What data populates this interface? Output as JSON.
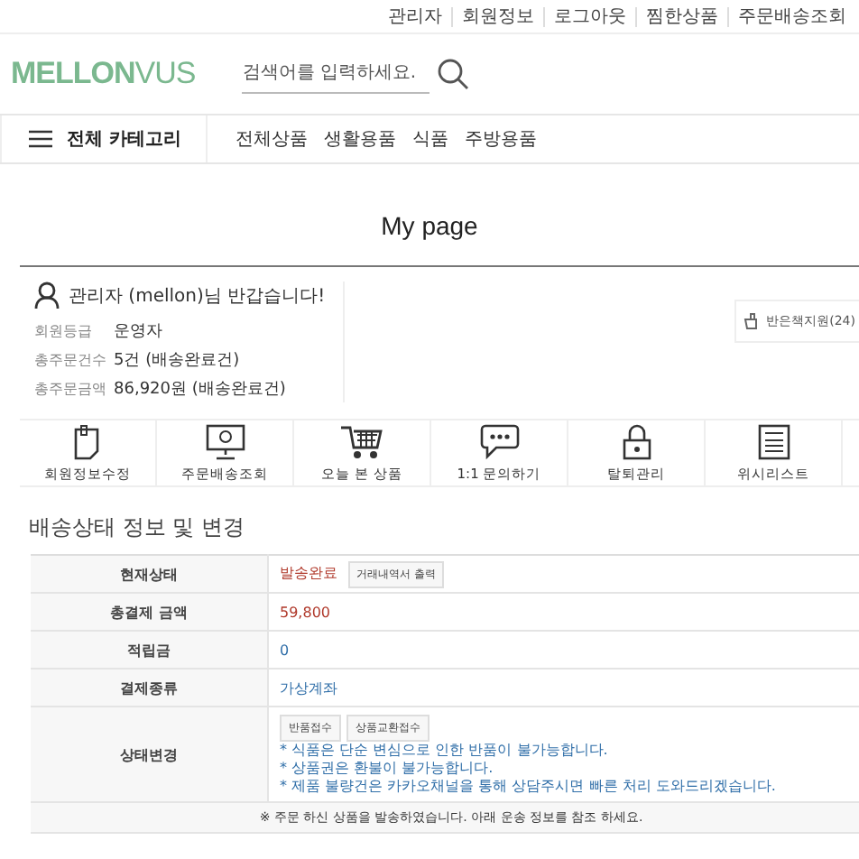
{
  "top_links": [
    "관리자",
    "회원정보",
    "로그아웃",
    "찜한상품",
    "주문배송조회"
  ],
  "logo": {
    "left": "MELLON",
    "right": "VUS"
  },
  "search": {
    "placeholder": "검색어를 입력하세요."
  },
  "nav": {
    "category_button": "전체 카테고리",
    "items": [
      "전체상품",
      "생활용품",
      "식품",
      "주방용품"
    ]
  },
  "page_title": "My page",
  "profile": {
    "greeting": "관리자 (mellon)님 반갑습니다!",
    "fields": [
      {
        "label": "회원등급",
        "value": "운영자"
      },
      {
        "label": "총주문건수",
        "value": "5건 (배송완료건)"
      },
      {
        "label": "총주문금액",
        "value": "86,920원 (배송완료건)"
      }
    ],
    "side_button": "반은책지원(24)"
  },
  "shortcuts": [
    {
      "label": "회원정보수정",
      "kind": "edit"
    },
    {
      "label": "주문배송조회",
      "kind": "monitor"
    },
    {
      "label": "오늘 본 상품",
      "kind": "cart"
    },
    {
      "label": "1:1 문의하기",
      "kind": "chat"
    },
    {
      "label": "탈퇴관리",
      "kind": "lock"
    },
    {
      "label": "위시리스트",
      "kind": "list"
    }
  ],
  "section_title": "배송상태 정보 및 변경",
  "rows": [
    {
      "label": "현재상태",
      "kind": "status",
      "value": "발송완료",
      "button": "거래내역서 출력"
    },
    {
      "label": "총결제 금액",
      "kind": "amount",
      "value": "59,800"
    },
    {
      "label": "적립금",
      "kind": "points",
      "value": "0"
    },
    {
      "label": "결제종류",
      "kind": "payment",
      "value": "가상계좌"
    },
    {
      "label": "상태변경",
      "kind": "change",
      "buttons": [
        "반품접수",
        "상품교환접수"
      ],
      "notes": [
        "* 식품은 단순 변심으로 인한 반품이 불가능합니다.",
        "* 상품권은 환불이 불가능합니다.",
        "* 제품 불량건은 카카오채널을 통해 상담주시면 빠른 처리 도와드리겠습니다."
      ]
    }
  ],
  "footer_note": "※ 주문 하신 상품을 발송하였습니다. 아래 운송 정보를 참조 하세요."
}
